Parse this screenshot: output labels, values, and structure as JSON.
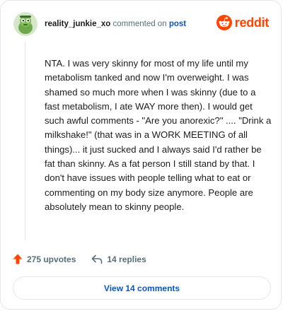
{
  "comment": {
    "username": "reality_junkie_xo",
    "commented_text": "commented on",
    "post_link": "post",
    "body": "NTA. I was very skinny for most of my life until my metabolism tanked and now I'm overweight. I was shamed so much more when I was skinny (due to a fast metabolism, I ate WAY more then). I would get such awful comments - \"Are you anorexic?\" .... \"Drink a milkshake!\" (that was in a WORK MEETING of all things)... it just sucked and I always said I'd rather be fat than skinny. As a fat person I still stand by that. I don't have issues with people telling what to eat or commenting on my body size anymore. People are absolutely mean to skinny people."
  },
  "brand": {
    "name": "reddit",
    "color": "#ff4500",
    "icon": "reddit-snoo-icon"
  },
  "actions": {
    "upvotes": "275 upvotes",
    "replies": "14 replies",
    "upvote_icon": "upvote-arrow-icon",
    "reply_icon": "reply-arrow-icon"
  },
  "view_comments_label": "View 14 comments",
  "colors": {
    "link": "#0a57c2",
    "upvote": "#ff4500",
    "muted": "#576f76",
    "border": "#e5e7ea"
  }
}
